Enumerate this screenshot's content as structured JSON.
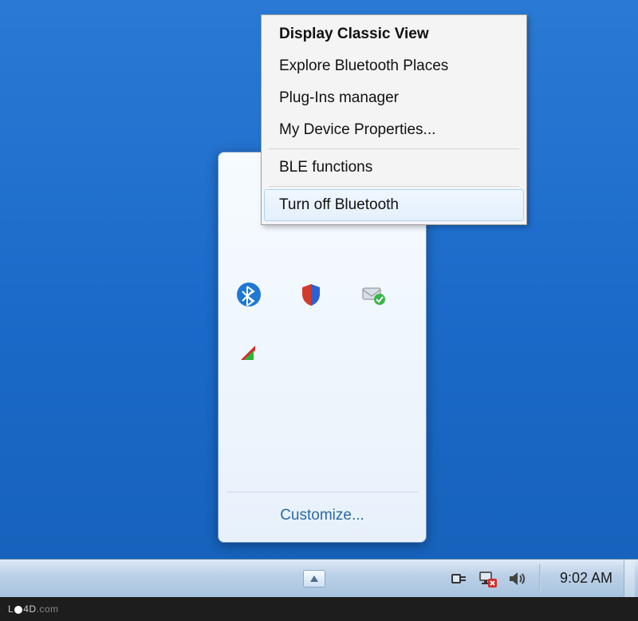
{
  "context_menu": {
    "items": [
      {
        "label": "Display Classic View",
        "bold": true
      },
      {
        "label": "Explore Bluetooth Places",
        "bold": false
      },
      {
        "label": "Plug-Ins manager",
        "bold": false
      },
      {
        "label": "My Device Properties...",
        "bold": false
      }
    ],
    "ble_label": "BLE functions",
    "turnoff_label": "Turn off Bluetooth"
  },
  "tray_popup": {
    "customize_label": "Customize...",
    "icons": [
      "bluetooth-icon",
      "shield-icon",
      "mail-check-icon",
      "arrow-icon"
    ]
  },
  "taskbar": {
    "clock": "9:02 AM",
    "icons": [
      "power-plug-icon",
      "network-error-icon",
      "volume-icon"
    ]
  },
  "footer": {
    "text_before": "L",
    "text_mid": "4D",
    "text_after": ".com"
  }
}
